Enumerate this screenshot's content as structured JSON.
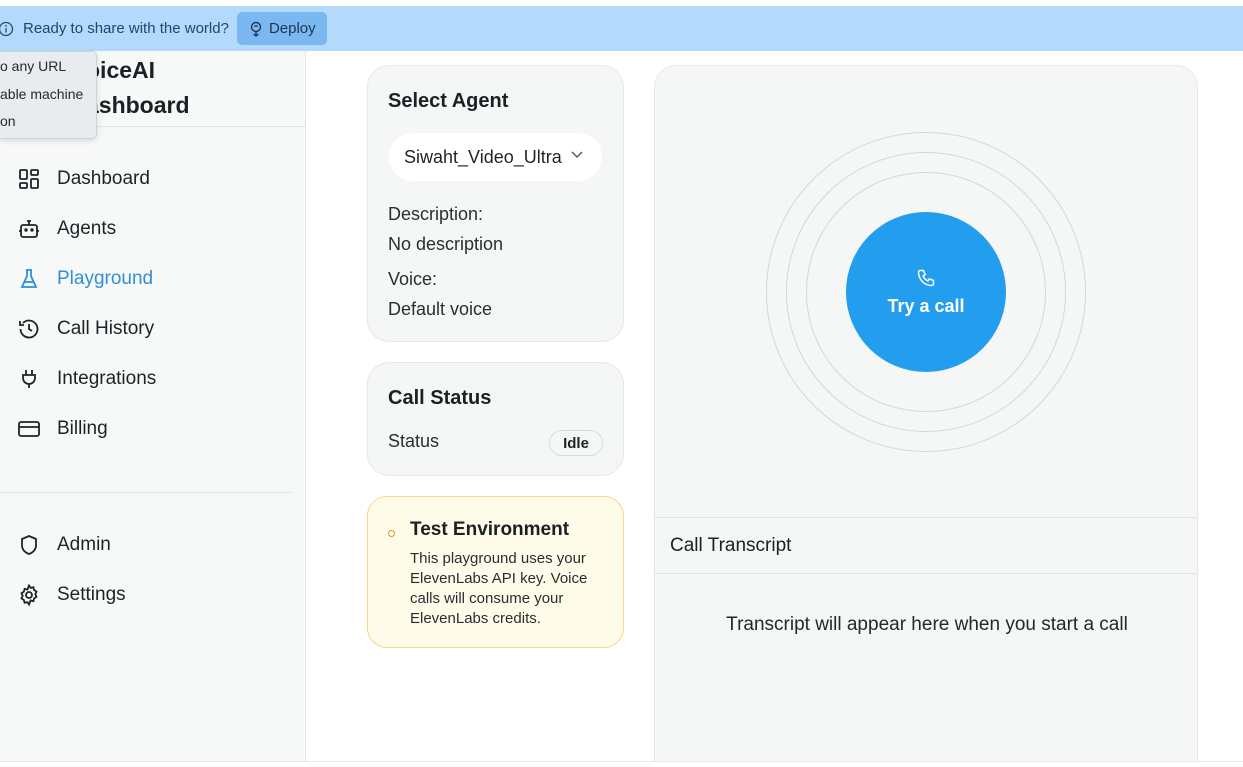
{
  "banner": {
    "message": "Ready to share with the world?",
    "deploy_label": "Deploy"
  },
  "tooltip": {
    "lines": [
      "o any URL",
      "able machine",
      "on"
    ]
  },
  "brand": {
    "line1": "oiceAI",
    "line2": "ashboard"
  },
  "sidebar": {
    "items": [
      {
        "label": "Dashboard",
        "icon": "dashboard-grid-icon"
      },
      {
        "label": "Agents",
        "icon": "robot-icon"
      },
      {
        "label": "Playground",
        "icon": "flask-icon",
        "active": true
      },
      {
        "label": "Call History",
        "icon": "history-icon"
      },
      {
        "label": "Integrations",
        "icon": "plug-icon"
      },
      {
        "label": "Billing",
        "icon": "credit-card-icon"
      }
    ],
    "bottom_items": [
      {
        "label": "Admin",
        "icon": "shield-icon"
      },
      {
        "label": "Settings",
        "icon": "gear-icon"
      }
    ]
  },
  "select_agent": {
    "title": "Select Agent",
    "selected": "Siwaht_Video_Ultra",
    "description_label": "Description:",
    "description_value": "No description",
    "voice_label": "Voice:",
    "voice_value": "Default voice"
  },
  "call_status": {
    "title": "Call Status",
    "status_label": "Status",
    "status_value": "Idle"
  },
  "test_env": {
    "title": "Test Environment",
    "body": "This playground uses your ElevenLabs API key. Voice calls will consume your ElevenLabs credits."
  },
  "call": {
    "button_label": "Try a call"
  },
  "transcript": {
    "title": "Call Transcript",
    "empty": "Transcript will appear here when you start a call"
  },
  "colors": {
    "accent": "#239ded",
    "active_nav": "#2f8fd8",
    "banner_bg": "#b3d9fb"
  }
}
